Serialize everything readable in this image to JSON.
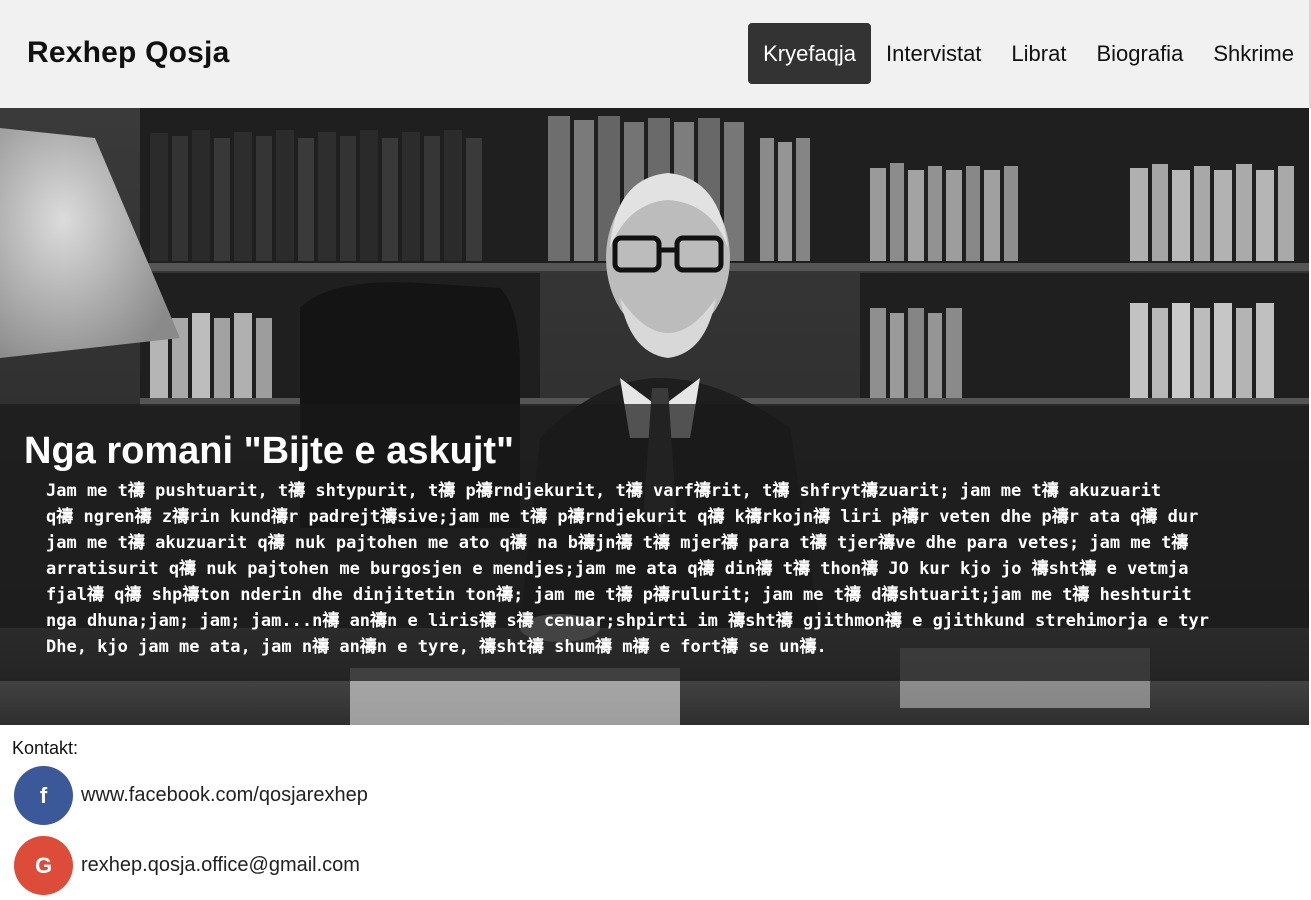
{
  "brand": "Rexhep Qosja",
  "nav": {
    "items": [
      "Kryefaqja",
      "Intervistat",
      "Librat",
      "Biografia",
      "Shkrime"
    ],
    "active": "Kryefaqja"
  },
  "hero": {
    "title": "Nga romani \"Bijte e askujt\"",
    "lines": [
      "Jam me t禱 pushtuarit, t禱 shtypurit, t禱 p禱rndjekurit, t禱 varf禱rit, t禱 shfryt禱zuarit; jam me t禱 akuzuarit",
      "q禱 ngren禱 z禱rin kund禱r padrejt禱sive;jam me t禱 p禱rndjekurit q禱 k禱rkojn禱 liri p禱r veten dhe p禱r ata q禱 dur",
      "jam me t禱 akuzuarit q禱 nuk pajtohen me ato q禱 na b禱jn禱 t禱 mjer禱 para t禱 tjer禱ve dhe para vetes; jam me t禱",
      "arratisurit q禱 nuk pajtohen me burgosjen e mendjes;jam me ata q禱 din禱 t禱 thon禱 JO kur kjo jo 禱sht禱 e vetmja",
      "fjal禱 q禱 shp禱ton nderin dhe dinjitetin ton禱; jam me t禱 p禱rulurit; jam me t禱 d禱shtuarit;jam me t禱 heshturit",
      "nga dhuna;jam; jam; jam...n禱 an禱n e liris禱 s禱 cenuar;shpirti im 禱sht禱 gjithmon禱 e gjithkund strehimorja e tyr",
      "Dhe, kjo jam me ata, jam n禱 an禱n e tyre, 禱sht禱 shum禱 m禱 e fort禱 se un禱."
    ]
  },
  "contact": {
    "heading": "Kontakt:",
    "facebook": {
      "icon": "facebook-icon",
      "glyph": "f",
      "text": "www.facebook.com/qosjarexhep",
      "color": "#3b5998"
    },
    "google": {
      "icon": "google-icon",
      "glyph": "G",
      "text": "rexhep.qosja.office@gmail.com",
      "color": "#dd4b39"
    }
  },
  "colors": {
    "navbar_bg": "#f1f1f1",
    "active_bg": "#333333"
  }
}
